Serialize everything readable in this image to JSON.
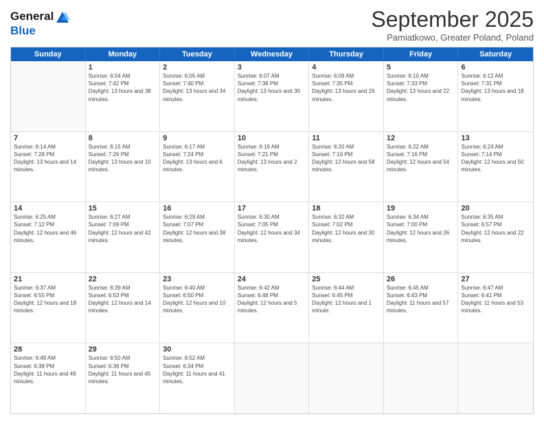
{
  "header": {
    "logo_line1": "General",
    "logo_line2": "Blue",
    "month_title": "September 2025",
    "subtitle": "Pamiatkowo, Greater Poland, Poland"
  },
  "day_headers": [
    "Sunday",
    "Monday",
    "Tuesday",
    "Wednesday",
    "Thursday",
    "Friday",
    "Saturday"
  ],
  "weeks": [
    [
      {
        "date": "",
        "empty": true
      },
      {
        "date": "1",
        "sunrise": "Sunrise: 6:04 AM",
        "sunset": "Sunset: 7:42 PM",
        "daylight": "Daylight: 13 hours and 38 minutes."
      },
      {
        "date": "2",
        "sunrise": "Sunrise: 6:05 AM",
        "sunset": "Sunset: 7:40 PM",
        "daylight": "Daylight: 13 hours and 34 minutes."
      },
      {
        "date": "3",
        "sunrise": "Sunrise: 6:07 AM",
        "sunset": "Sunset: 7:38 PM",
        "daylight": "Daylight: 13 hours and 30 minutes."
      },
      {
        "date": "4",
        "sunrise": "Sunrise: 6:09 AM",
        "sunset": "Sunset: 7:35 PM",
        "daylight": "Daylight: 13 hours and 26 minutes."
      },
      {
        "date": "5",
        "sunrise": "Sunrise: 6:10 AM",
        "sunset": "Sunset: 7:33 PM",
        "daylight": "Daylight: 13 hours and 22 minutes."
      },
      {
        "date": "6",
        "sunrise": "Sunrise: 6:12 AM",
        "sunset": "Sunset: 7:31 PM",
        "daylight": "Daylight: 13 hours and 18 minutes."
      }
    ],
    [
      {
        "date": "7",
        "sunrise": "Sunrise: 6:14 AM",
        "sunset": "Sunset: 7:28 PM",
        "daylight": "Daylight: 13 hours and 14 minutes."
      },
      {
        "date": "8",
        "sunrise": "Sunrise: 6:15 AM",
        "sunset": "Sunset: 7:26 PM",
        "daylight": "Daylight: 13 hours and 10 minutes."
      },
      {
        "date": "9",
        "sunrise": "Sunrise: 6:17 AM",
        "sunset": "Sunset: 7:24 PM",
        "daylight": "Daylight: 13 hours and 6 minutes."
      },
      {
        "date": "10",
        "sunrise": "Sunrise: 6:19 AM",
        "sunset": "Sunset: 7:21 PM",
        "daylight": "Daylight: 13 hours and 2 minutes."
      },
      {
        "date": "11",
        "sunrise": "Sunrise: 6:20 AM",
        "sunset": "Sunset: 7:19 PM",
        "daylight": "Daylight: 12 hours and 58 minutes."
      },
      {
        "date": "12",
        "sunrise": "Sunrise: 6:22 AM",
        "sunset": "Sunset: 7:16 PM",
        "daylight": "Daylight: 12 hours and 54 minutes."
      },
      {
        "date": "13",
        "sunrise": "Sunrise: 6:24 AM",
        "sunset": "Sunset: 7:14 PM",
        "daylight": "Daylight: 12 hours and 50 minutes."
      }
    ],
    [
      {
        "date": "14",
        "sunrise": "Sunrise: 6:25 AM",
        "sunset": "Sunset: 7:12 PM",
        "daylight": "Daylight: 12 hours and 46 minutes."
      },
      {
        "date": "15",
        "sunrise": "Sunrise: 6:27 AM",
        "sunset": "Sunset: 7:09 PM",
        "daylight": "Daylight: 12 hours and 42 minutes."
      },
      {
        "date": "16",
        "sunrise": "Sunrise: 6:29 AM",
        "sunset": "Sunset: 7:07 PM",
        "daylight": "Daylight: 12 hours and 38 minutes."
      },
      {
        "date": "17",
        "sunrise": "Sunrise: 6:30 AM",
        "sunset": "Sunset: 7:05 PM",
        "daylight": "Daylight: 12 hours and 34 minutes."
      },
      {
        "date": "18",
        "sunrise": "Sunrise: 6:32 AM",
        "sunset": "Sunset: 7:02 PM",
        "daylight": "Daylight: 12 hours and 30 minutes."
      },
      {
        "date": "19",
        "sunrise": "Sunrise: 6:34 AM",
        "sunset": "Sunset: 7:00 PM",
        "daylight": "Daylight: 12 hours and 26 minutes."
      },
      {
        "date": "20",
        "sunrise": "Sunrise: 6:35 AM",
        "sunset": "Sunset: 6:57 PM",
        "daylight": "Daylight: 12 hours and 22 minutes."
      }
    ],
    [
      {
        "date": "21",
        "sunrise": "Sunrise: 6:37 AM",
        "sunset": "Sunset: 6:55 PM",
        "daylight": "Daylight: 12 hours and 18 minutes."
      },
      {
        "date": "22",
        "sunrise": "Sunrise: 6:39 AM",
        "sunset": "Sunset: 6:53 PM",
        "daylight": "Daylight: 12 hours and 14 minutes."
      },
      {
        "date": "23",
        "sunrise": "Sunrise: 6:40 AM",
        "sunset": "Sunset: 6:50 PM",
        "daylight": "Daylight: 12 hours and 10 minutes."
      },
      {
        "date": "24",
        "sunrise": "Sunrise: 6:42 AM",
        "sunset": "Sunset: 6:48 PM",
        "daylight": "Daylight: 12 hours and 5 minutes."
      },
      {
        "date": "25",
        "sunrise": "Sunrise: 6:44 AM",
        "sunset": "Sunset: 6:45 PM",
        "daylight": "Daylight: 12 hours and 1 minute."
      },
      {
        "date": "26",
        "sunrise": "Sunrise: 6:45 AM",
        "sunset": "Sunset: 6:43 PM",
        "daylight": "Daylight: 11 hours and 57 minutes."
      },
      {
        "date": "27",
        "sunrise": "Sunrise: 6:47 AM",
        "sunset": "Sunset: 6:41 PM",
        "daylight": "Daylight: 11 hours and 53 minutes."
      }
    ],
    [
      {
        "date": "28",
        "sunrise": "Sunrise: 6:49 AM",
        "sunset": "Sunset: 6:38 PM",
        "daylight": "Daylight: 11 hours and 49 minutes."
      },
      {
        "date": "29",
        "sunrise": "Sunrise: 6:50 AM",
        "sunset": "Sunset: 6:36 PM",
        "daylight": "Daylight: 11 hours and 45 minutes."
      },
      {
        "date": "30",
        "sunrise": "Sunrise: 6:52 AM",
        "sunset": "Sunset: 6:34 PM",
        "daylight": "Daylight: 11 hours and 41 minutes."
      },
      {
        "date": "",
        "empty": true
      },
      {
        "date": "",
        "empty": true
      },
      {
        "date": "",
        "empty": true
      },
      {
        "date": "",
        "empty": true
      }
    ]
  ]
}
